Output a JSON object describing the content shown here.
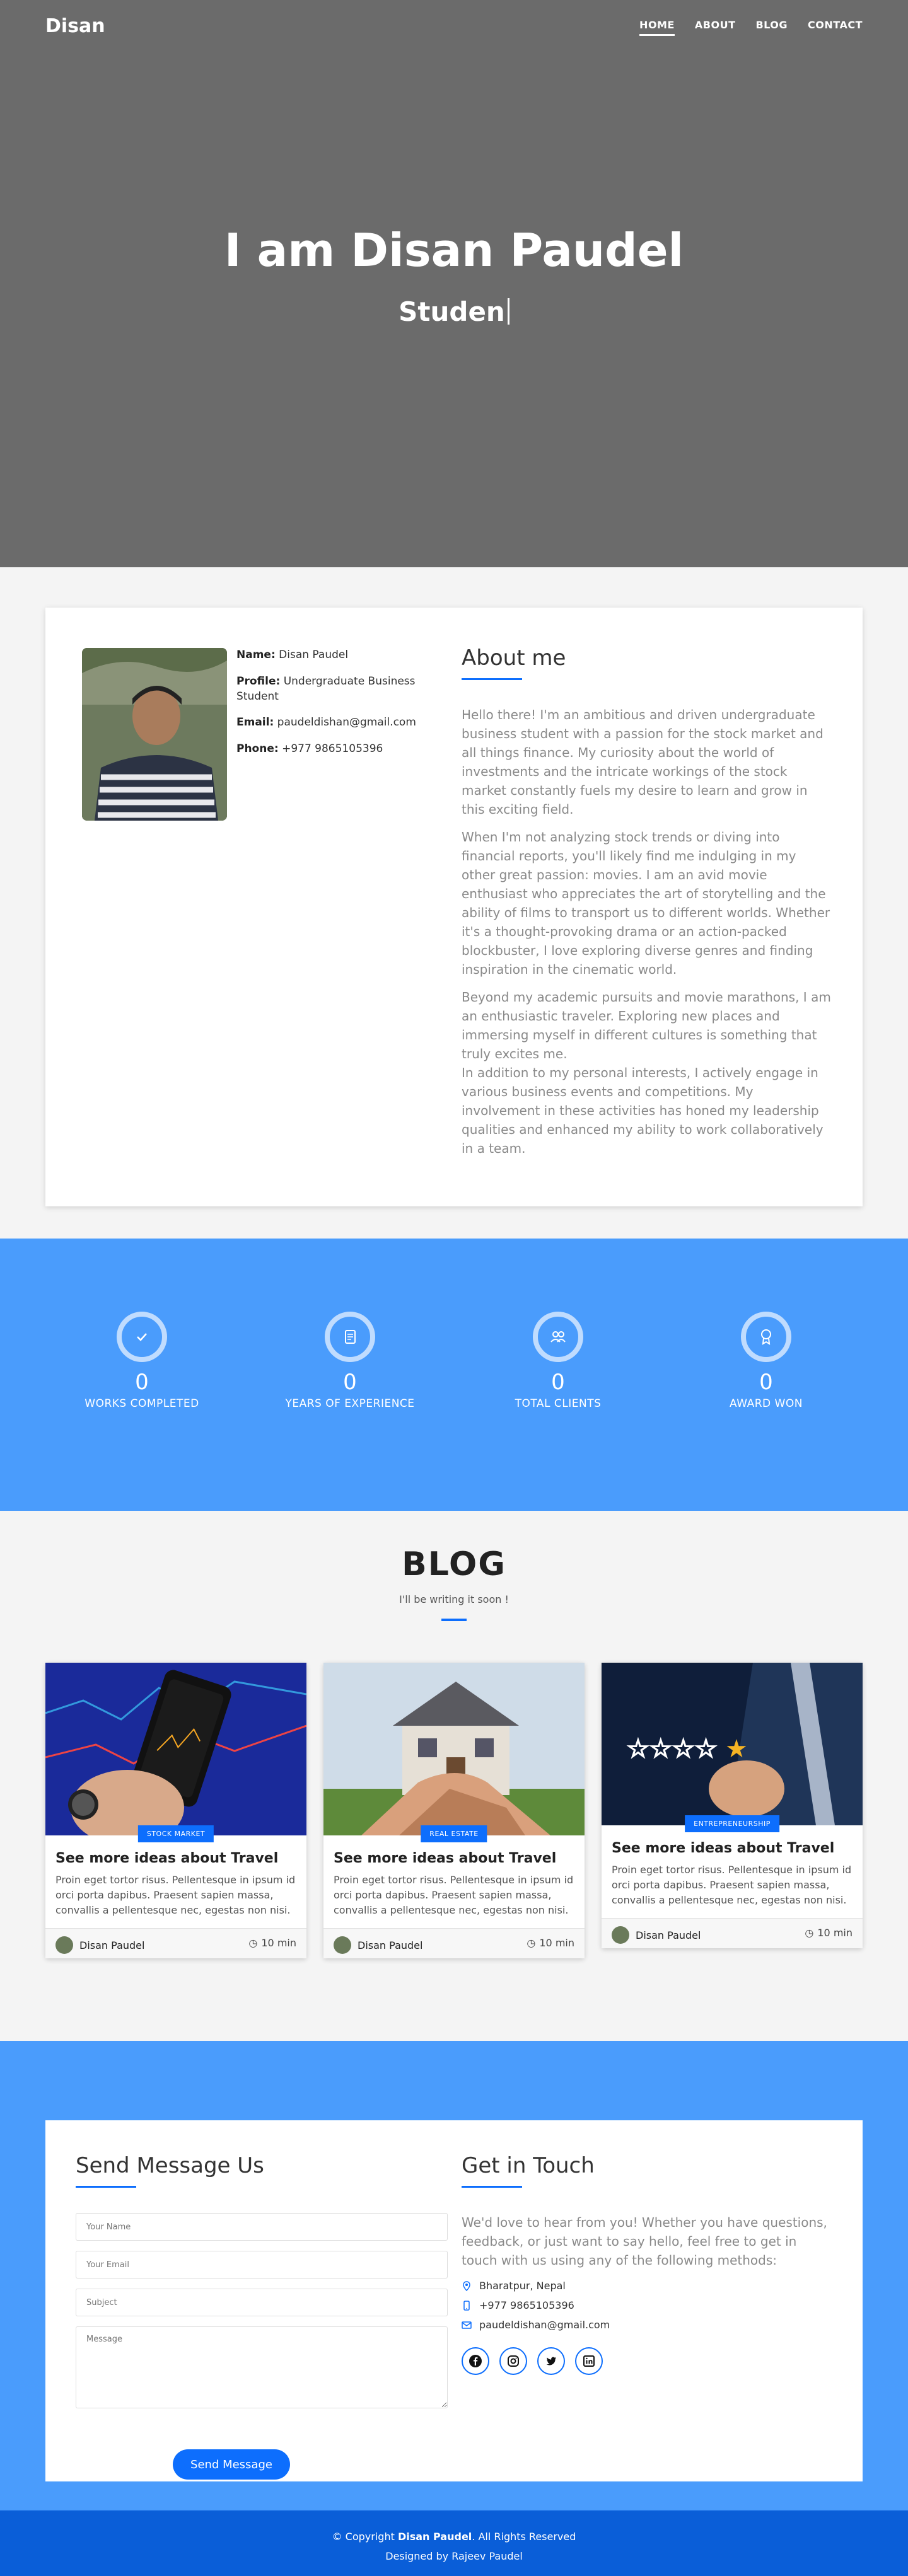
{
  "nav": {
    "brand": "Disan",
    "items": [
      {
        "label": "HOME",
        "active": true
      },
      {
        "label": "ABOUT",
        "active": false
      },
      {
        "label": "BLOG",
        "active": false
      },
      {
        "label": "CONTACT",
        "active": false
      }
    ]
  },
  "hero": {
    "title": "I am Disan Paudel",
    "subtitle": "Studen"
  },
  "about": {
    "info": [
      {
        "key": "Name:",
        "value": "Disan Paudel"
      },
      {
        "key": "Profile:",
        "value": "Undergraduate Business Student"
      },
      {
        "key": "Email:",
        "value": "paudeldishan@gmail.com"
      },
      {
        "key": "Phone:",
        "value": "+977 9865105396"
      }
    ],
    "heading": "About me",
    "paragraphs": [
      "Hello there! I'm an ambitious and driven undergraduate business student with a passion for the stock market and all things finance. My curiosity about the world of investments and the intricate workings of the stock market constantly fuels my desire to learn and grow in this exciting field.",
      "When I'm not analyzing stock trends or diving into financial reports, you'll likely find me indulging in my other great passion: movies. I am an avid movie enthusiast who appreciates the art of storytelling and the ability of films to transport us to different worlds. Whether it's a thought-provoking drama or an action-packed blockbuster, I love exploring diverse genres and finding inspiration in the cinematic world.",
      "Beyond my academic pursuits and movie marathons, I am an enthusiastic traveler. Exploring new places and immersing myself in different cultures is something that truly excites me.",
      "In addition to my personal interests, I actively engage in various business events and competitions. My involvement in these activities has honed my leadership qualities and enhanced my ability to work collaboratively in a team."
    ]
  },
  "stats": [
    {
      "icon": "check-icon",
      "value": "0",
      "label": "WORKS COMPLETED"
    },
    {
      "icon": "document-icon",
      "value": "0",
      "label": "YEARS OF EXPERIENCE"
    },
    {
      "icon": "users-icon",
      "value": "0",
      "label": "TOTAL CLIENTS"
    },
    {
      "icon": "award-icon",
      "value": "0",
      "label": "AWARD WON"
    }
  ],
  "blog": {
    "heading": "BLOG",
    "subtitle": "I'll be writing it soon !",
    "cards": [
      {
        "badge": "STOCK MARKET",
        "title": "See more ideas about Travel",
        "text": "Proin eget tortor risus. Pellentesque in ipsum id orci porta dapibus. Praesent sapien massa, convallis a pellentesque nec, egestas non nisi.",
        "author": "Disan Paudel",
        "time": "10 min"
      },
      {
        "badge": "REAL ESTATE",
        "title": "See more ideas about Travel",
        "text": "Proin eget tortor risus. Pellentesque in ipsum id orci porta dapibus. Praesent sapien massa, convallis a pellentesque nec, egestas non nisi.",
        "author": "Disan Paudel",
        "time": "10 min"
      },
      {
        "badge": "ENTREPRENEURSHIP",
        "title": "See more ideas about Travel",
        "text": "Proin eget tortor risus. Pellentesque in ipsum id orci porta dapibus. Praesent sapien massa, convallis a pellentesque nec, egestas non nisi.",
        "author": "Disan Paudel",
        "time": "10 min"
      }
    ]
  },
  "contact": {
    "form_heading": "Send Message Us",
    "placeholders": {
      "name": "Your Name",
      "email": "Your Email",
      "subject": "Subject",
      "message": "Message"
    },
    "send_label": "Send Message",
    "touch_heading": "Get in Touch",
    "lead": "We'd love to hear from you! Whether you have questions, feedback, or just want to say hello, feel free to get in touch with us using any of the following methods:",
    "location": "Bharatpur, Nepal",
    "phone": "+977 9865105396",
    "email": "paudeldishan@gmail.com",
    "socials": [
      "facebook-icon",
      "instagram-icon",
      "twitter-icon",
      "linkedin-icon"
    ]
  },
  "footer": {
    "copyright_prefix": "© Copyright",
    "copyright_name": "Disan Paudel",
    "copyright_suffix": ". All Rights Reserved",
    "designed": "Designed by Rajeev Paudel"
  },
  "colors": {
    "accent": "#0d6efd",
    "stats_bg": "#4a9cfc",
    "hero_bg": "#6b6b6b",
    "footer_bg": "#0a5ed8"
  }
}
